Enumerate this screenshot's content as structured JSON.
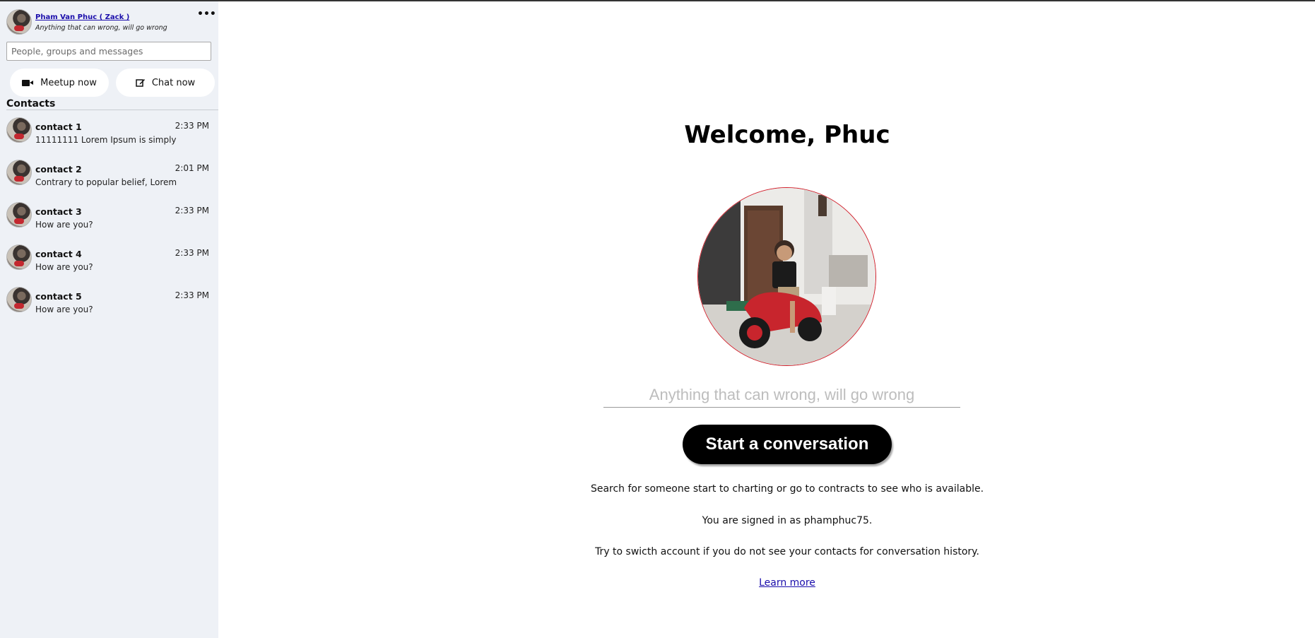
{
  "profile": {
    "name": "Pham Van Phuc ( Zack )",
    "status": "Anything that can wrong, will go wrong",
    "more_label": "•••"
  },
  "search": {
    "placeholder": "People, groups and messages"
  },
  "actions": {
    "meetup_label": "Meetup now",
    "chat_label": "Chat now"
  },
  "contacts": {
    "title": "Contacts",
    "items": [
      {
        "name": "contact 1",
        "time": "2:33 PM",
        "message": "11111111 Lorem Ipsum is simply"
      },
      {
        "name": "contact 2",
        "time": "2:01 PM",
        "message": "Contrary to popular belief, Lorem"
      },
      {
        "name": "contact 3",
        "time": "2:33 PM",
        "message": "How are you?"
      },
      {
        "name": "contact 4",
        "time": "2:33 PM",
        "message": "How are you?"
      },
      {
        "name": "contact 5",
        "time": "2:33 PM",
        "message": "How are you?"
      }
    ]
  },
  "main": {
    "welcome": "Welcome, Phuc",
    "status_placeholder": "Anything that can wrong, will go wrong",
    "start_button": "Start a conversation",
    "info_search": "Search for someone start to charting or go to contracts to see who is available.",
    "info_signed_in": "You are signed in as phamphuc75.",
    "info_switch": "Try to swicth account if you do not see your contacts for conversation history.",
    "learn_more": "Learn more"
  },
  "colors": {
    "sidebar_bg": "#eef1f6",
    "accent_link": "#1a0dab",
    "hero_border": "#d21f2b",
    "button_bg": "#000000"
  }
}
